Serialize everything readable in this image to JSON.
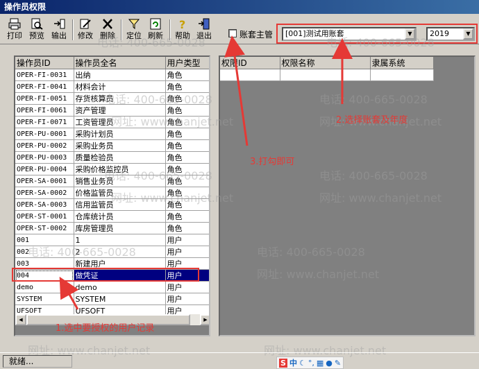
{
  "window": {
    "title": "操作员权限"
  },
  "toolbar": {
    "print": "打印",
    "preview": "预览",
    "export": "输出",
    "modify": "修改",
    "delete": "删除",
    "locate": "定位",
    "refresh": "刷新",
    "help": "帮助",
    "exit": "退出"
  },
  "options": {
    "master_checkbox_label": "账套主管",
    "master_checked": false,
    "account_set": "[001]测试用账套",
    "year": "2019"
  },
  "operators": {
    "columns": [
      "操作员ID",
      "操作员全名",
      "用户类型"
    ],
    "rows": [
      [
        "OPER-FI-0031",
        "出纳",
        "角色"
      ],
      [
        "OPER-FI-0041",
        "材料会计",
        "角色"
      ],
      [
        "OPER-FI-0051",
        "存货核算员",
        "角色"
      ],
      [
        "OPER-FI-0061",
        "资产管理",
        "角色"
      ],
      [
        "OPER-FI-0071",
        "工资管理员",
        "角色"
      ],
      [
        "OPER-PU-0001",
        "采购计划员",
        "角色"
      ],
      [
        "OPER-PU-0002",
        "采购业务员",
        "角色"
      ],
      [
        "OPER-PU-0003",
        "质量检验员",
        "角色"
      ],
      [
        "OPER-PU-0004",
        "采购价格监控员",
        "角色"
      ],
      [
        "OPER-SA-0001",
        "销售业务员",
        "角色"
      ],
      [
        "OPER-SA-0002",
        "价格监管员",
        "角色"
      ],
      [
        "OPER-SA-0003",
        "信用监管员",
        "角色"
      ],
      [
        "OPER-ST-0001",
        "仓库统计员",
        "角色"
      ],
      [
        "OPER-ST-0002",
        "库房管理员",
        "角色"
      ],
      [
        "001",
        "1",
        "用户"
      ],
      [
        "002",
        "2",
        "用户"
      ],
      [
        "003",
        "新建用户",
        "用户"
      ],
      [
        "004",
        "做凭证",
        "用户"
      ],
      [
        "demo",
        "demo",
        "用户"
      ],
      [
        "SYSTEM",
        "SYSTEM",
        "用户"
      ],
      [
        "UFSOFT",
        "UFSOFT",
        "用户"
      ]
    ],
    "selected_index": 17
  },
  "permissions": {
    "columns": [
      "权限ID",
      "权限名称",
      "隶属系统"
    ]
  },
  "annotations": {
    "step1": "1.选中要授权的用户记录",
    "step2": "2.选择账套及年度",
    "step3": "3.打勾即可"
  },
  "watermark": {
    "phone": "电话: 400-665-0028",
    "site": "网址: www.chanjet.net"
  },
  "status": {
    "text": "就绪..."
  },
  "colors": {
    "annotation_red": "#e53935",
    "selection": "#000080"
  }
}
